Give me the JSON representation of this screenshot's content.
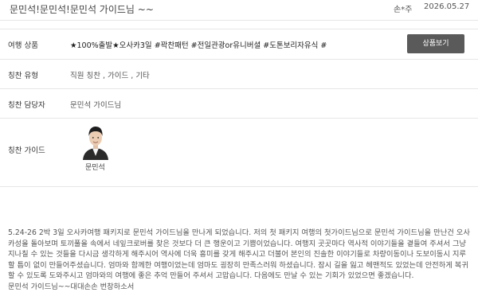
{
  "header": {
    "title": "문민석!문민석!문민석 가이드님 ~~",
    "author": "손*주",
    "date": "2026.05.27"
  },
  "product": {
    "label": "여행 상품",
    "value": "★100%출발★오사카3일 #꽉찬패턴 #전일관광or유니버셜 #도톤보리자유식 #오...",
    "button_label": "상품보기"
  },
  "praise_type": {
    "label": "칭찬 유형",
    "value": "직원 칭찬 , 가이드 , 기타"
  },
  "praise_staff": {
    "label": "칭찬 담당자",
    "value": "문민석 가이드님"
  },
  "praise_guide": {
    "label": "칭찬 가이드",
    "guide_name": "문민석"
  },
  "review": {
    "lines": [
      "5.24-26 2박 3일 오사카여행 패키지로 문민석 가이드님을 만나게 되었습니다. 저의 첫 패키지 여행의 첫가이드님으로 문민석 가이드님을 만난건 오사",
      "카성을 돌아보며 토끼풀을 속에서 네잎크로버를 찾은 것보다 더 큰 행운이고 기쁨이었습니다. 여행지 곳곳마다 역사적 이야기들을 곁들여 주셔서 그냥",
      "지나칠 수 있는 것들을 다시금 생각하게 해주시어 역사에 더욱 흥미를 갖게 해주시고 더불어 본인의 진솔한 이야기들로 차량이동이나 도보이동시 지루",
      "할 틈이 없이 만들어주셨습니다. 엄마와 함께한 여행이었는데 엄마도 굉장히 만족스러워 하셨습니다. 잠시 길을 잃고 헤맨적도 있었는데 안전하게 복귀",
      "할 수 있도록 도와주시고 엄마와의 여행에 좋은 추억 만들어 주셔서 고맙습니다. 다음에도 만날 수 있는 기회가 있었으면 좋겠습니다.",
      "문민석 가이드님~~대대손손 번창하소서"
    ]
  }
}
